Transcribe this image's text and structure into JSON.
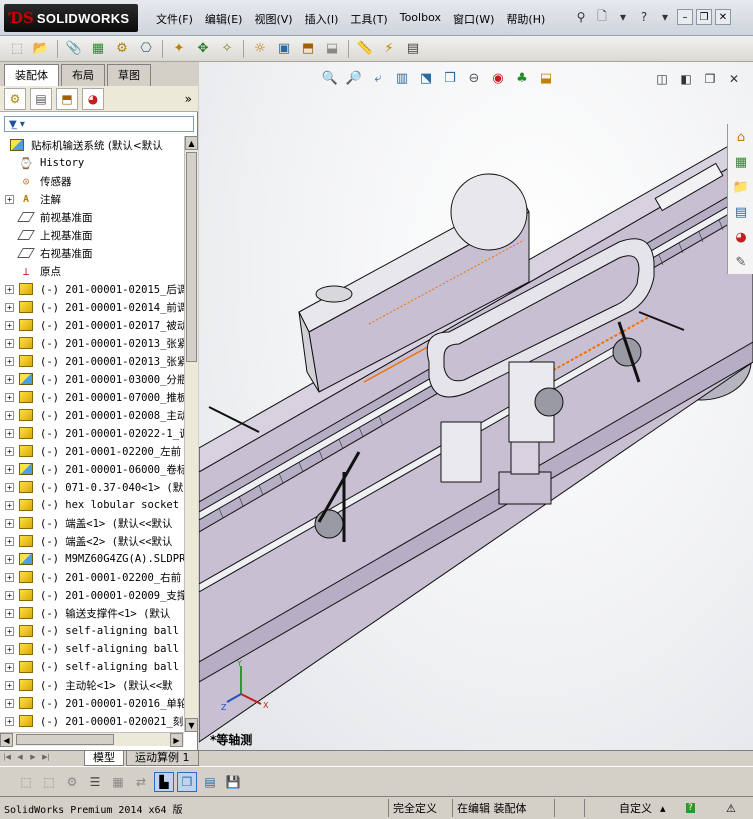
{
  "app": {
    "brand_ds": "ƊS",
    "brand_name": "SOLIDWORKS"
  },
  "menus": [
    "文件(F)",
    "编辑(E)",
    "视图(V)",
    "插入(I)",
    "工具(T)",
    "Toolbox",
    "窗口(W)",
    "帮助(H)"
  ],
  "left_panel": {
    "tabs": [
      "装配体",
      "布局",
      "草图"
    ],
    "active_tab": "装配体"
  },
  "tree": {
    "root": "贴标机输送系统 (默认<默认",
    "items": [
      {
        "icon": "history-icon",
        "label": "History",
        "expandable": false
      },
      {
        "icon": "sensor-icon",
        "label": "传感器",
        "expandable": false
      },
      {
        "icon": "annotation-icon",
        "label": "注解",
        "expandable": true
      },
      {
        "icon": "plane-icon",
        "label": "前视基准面",
        "expandable": false
      },
      {
        "icon": "plane-icon",
        "label": "上视基准面",
        "expandable": false
      },
      {
        "icon": "plane-icon",
        "label": "右视基准面",
        "expandable": false
      },
      {
        "icon": "origin-icon",
        "label": "原点",
        "expandable": false
      },
      {
        "icon": "part-icon",
        "label": "(-) 201-00001-02015_后调",
        "expandable": true
      },
      {
        "icon": "part-icon",
        "label": "(-) 201-00001-02014_前调",
        "expandable": true
      },
      {
        "icon": "part-icon",
        "label": "(-) 201-00001-02017_被动",
        "expandable": true
      },
      {
        "icon": "part-icon",
        "label": "(-) 201-00001-02013_张紧",
        "expandable": true
      },
      {
        "icon": "part-icon",
        "label": "(-) 201-00001-02013_张紧",
        "expandable": true
      },
      {
        "icon": "asm-icon",
        "label": "(-) 201-00001-03000_分瓶",
        "expandable": true
      },
      {
        "icon": "part-icon",
        "label": "(-) 201-00001-07000_推板",
        "expandable": true
      },
      {
        "icon": "part-icon",
        "label": "(-) 201-00001-02008_主动",
        "expandable": true
      },
      {
        "icon": "part-icon",
        "label": "(-) 201-00001-02022-1_调",
        "expandable": true
      },
      {
        "icon": "part-icon",
        "label": "(-) 201-0001-02200_左前",
        "expandable": true
      },
      {
        "icon": "asm-icon",
        "label": "(-) 201-00001-06000_卷标",
        "expandable": true
      },
      {
        "icon": "part-icon",
        "label": "(-) 071-0.37-040<1> (默",
        "expandable": true
      },
      {
        "icon": "part-icon",
        "label": "(-) hex lobular socket",
        "expandable": true
      },
      {
        "icon": "part-icon",
        "label": "(-) 端盖<1> (默认<<默认",
        "expandable": true
      },
      {
        "icon": "part-icon",
        "label": "(-) 端盖<2> (默认<<默认",
        "expandable": true
      },
      {
        "icon": "asm-icon",
        "label": "(-) M9MZ60G4ZG(A).SLDPR",
        "expandable": true
      },
      {
        "icon": "part-icon",
        "label": "(-) 201-0001-02200_右前",
        "expandable": true
      },
      {
        "icon": "part-icon",
        "label": "(-) 201-00001-02009_支撑",
        "expandable": true
      },
      {
        "icon": "part-icon",
        "label": "(-) 输送支撑件<1> (默认",
        "expandable": true
      },
      {
        "icon": "part-icon",
        "label": "(-) self-aligning ball",
        "expandable": true
      },
      {
        "icon": "part-icon",
        "label": "(-) self-aligning ball",
        "expandable": true
      },
      {
        "icon": "part-icon",
        "label": "(-) self-aligning ball",
        "expandable": true
      },
      {
        "icon": "part-icon",
        "label": "(-) 主动轮<1> (默认<<默",
        "expandable": true
      },
      {
        "icon": "part-icon",
        "label": "(-) 201-00001-02016_单轮",
        "expandable": true
      },
      {
        "icon": "part-icon",
        "label": "(-) 201-00001-020021_刻",
        "expandable": true
      }
    ]
  },
  "viewport": {
    "view_label": "*等轴测",
    "triad_x": "X",
    "triad_y": "Y",
    "triad_z": "Z"
  },
  "bottom_tabs": [
    "模型",
    "运动算例 1"
  ],
  "active_bottom_tab": "模型",
  "status": {
    "product": "SolidWorks Premium 2014 x64 版",
    "definition": "完全定义",
    "mode": "在编辑 装配体",
    "units": "自定义"
  },
  "colors": {
    "model_body": "#c8bfd2",
    "model_edge": "#000000",
    "highlight": "#f07000",
    "accent": "#316ac5"
  }
}
